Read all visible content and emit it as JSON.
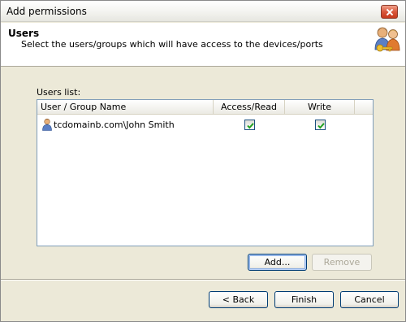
{
  "window": {
    "title": "Add permissions"
  },
  "header": {
    "title": "Users",
    "subtitle": "Select the users/groups which will have access  to the devices/ports",
    "icon": "users-key-icon"
  },
  "users_list": {
    "label": "Users list:",
    "columns": [
      "User / Group Name",
      "Access/Read",
      "Write"
    ],
    "rows": [
      {
        "name": "tcdomainb.com\\John Smith",
        "access_read": true,
        "write": true,
        "icon": "user-icon"
      }
    ]
  },
  "list_buttons": {
    "add": "Add...",
    "remove": "Remove"
  },
  "footer": {
    "back": "< Back",
    "finish": "Finish",
    "cancel": "Cancel"
  },
  "colors": {
    "check": "#21a121",
    "close_button": "#d9573b",
    "list_border": "#7f9db9"
  }
}
